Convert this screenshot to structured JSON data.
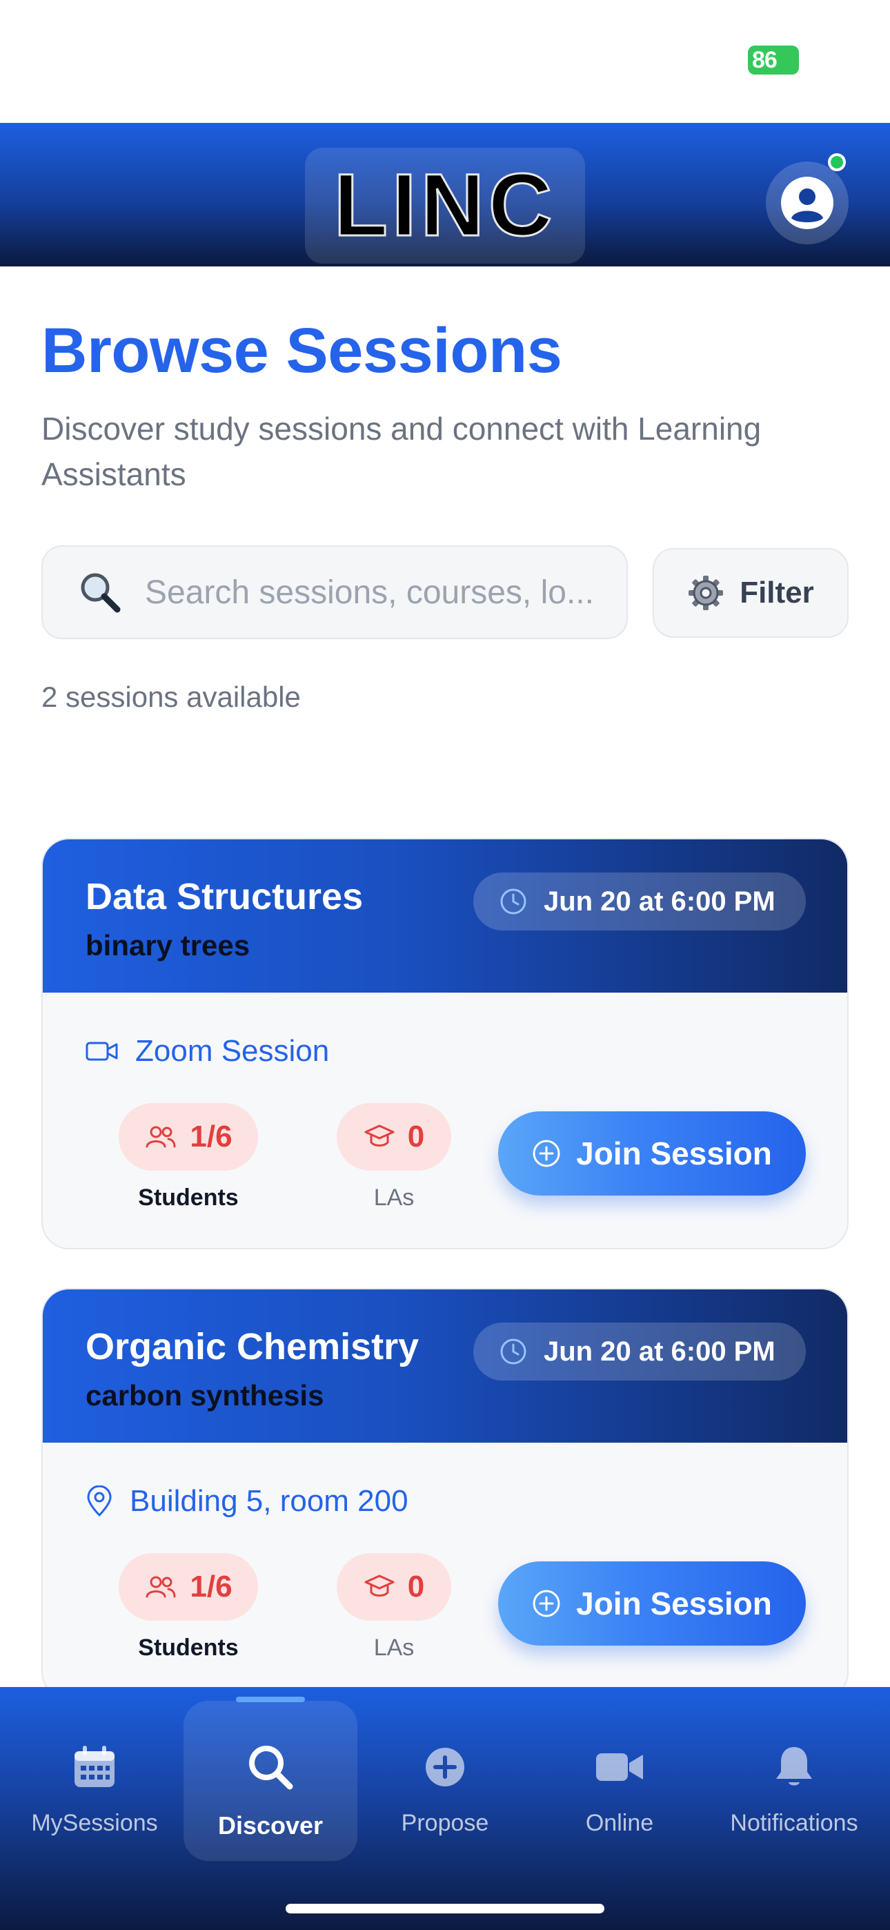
{
  "status_bar": {
    "battery": "86"
  },
  "header": {
    "logo_text": "LINC"
  },
  "page": {
    "title": "Browse Sessions",
    "subtitle": "Discover study sessions and connect with Learning Assistants"
  },
  "search": {
    "placeholder": "Search sessions, courses, lo..."
  },
  "filter": {
    "label": "Filter"
  },
  "sessions_count": "2 sessions available",
  "sessions": [
    {
      "course": "Data Structures",
      "topic": "binary trees",
      "time": "Jun 20 at 6:00 PM",
      "location_icon": "video-icon",
      "location": "Zoom Session",
      "students": "1/6",
      "students_label": "Students",
      "las": "0",
      "las_label": "LAs",
      "join_label": "Join Session"
    },
    {
      "course": "Organic Chemistry",
      "topic": "carbon synthesis",
      "time": "Jun 20 at 6:00 PM",
      "location_icon": "map-pin-icon",
      "location": "Building 5, room 200",
      "students": "1/6",
      "students_label": "Students",
      "las": "0",
      "las_label": "LAs",
      "join_label": "Join Session"
    }
  ],
  "bottom_nav": {
    "active": "Discover",
    "items": [
      {
        "label": "MySessions",
        "icon": "calendar-icon"
      },
      {
        "label": "Discover",
        "icon": "search-icon"
      },
      {
        "label": "Propose",
        "icon": "plus-circle-icon"
      },
      {
        "label": "Online",
        "icon": "video-icon"
      },
      {
        "label": "Notifications",
        "icon": "bell-icon"
      }
    ]
  },
  "colors": {
    "primary": "#2563eb",
    "header_dark": "#0b1a3f",
    "stat_bg": "#fde2e2",
    "stat_text": "#e0403f",
    "battery": "#34c759"
  }
}
